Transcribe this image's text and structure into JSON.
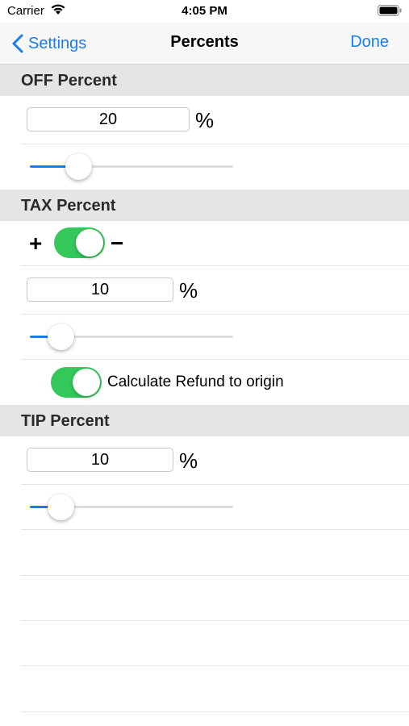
{
  "status_bar": {
    "carrier": "Carrier",
    "time": "4:05 PM"
  },
  "nav": {
    "back_label": "Settings",
    "title": "Percents",
    "done_label": "Done"
  },
  "off": {
    "header": "OFF Percent",
    "value": "20",
    "percent_sign": "%",
    "slider_fraction": 0.24
  },
  "tax": {
    "header": "TAX Percent",
    "plus_label": "+",
    "minus_label": "−",
    "sign_toggle_on": true,
    "value": "10",
    "percent_sign": "%",
    "slider_fraction": 0.15,
    "refund_label": "Calculate Refund to origin",
    "refund_toggle_on": true
  },
  "tip": {
    "header": "TIP Percent",
    "value": "10",
    "percent_sign": "%",
    "slider_fraction": 0.15
  },
  "colors": {
    "accent": "#1a7cf2",
    "switch_on": "#34c759",
    "section_bg": "#e5e5e7"
  }
}
